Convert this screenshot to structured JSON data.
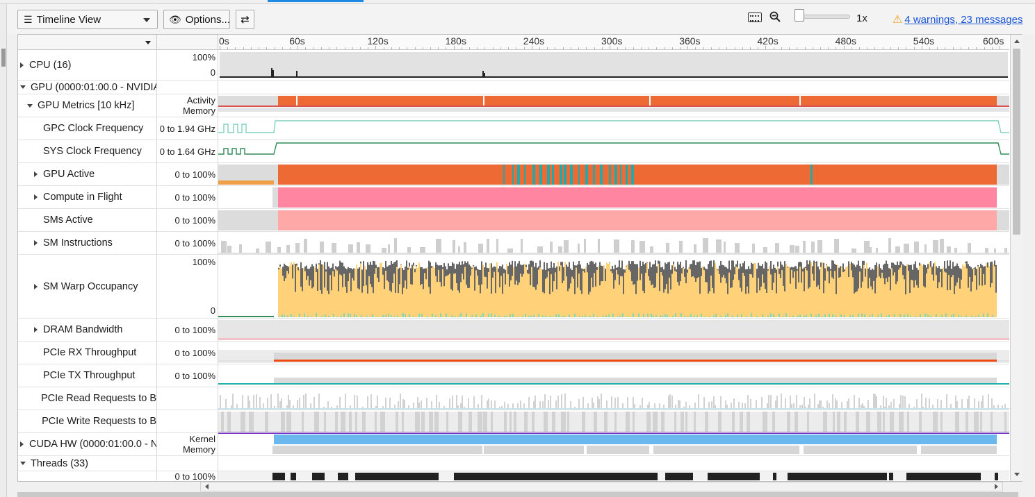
{
  "toolbar": {
    "view_label": "Timeline View",
    "options_label": "Options...",
    "zoom_level": "1x",
    "warnings_link": "4 warnings, 23 messages"
  },
  "ruler": {
    "ticks": [
      "0s",
      "60s",
      "120s",
      "180s",
      "240s",
      "300s",
      "360s",
      "420s",
      "480s",
      "540s",
      "600s"
    ]
  },
  "rows": [
    {
      "id": "cpu",
      "label": "CPU (16)",
      "expander": "collapsed",
      "indent": 0,
      "scale_top": "100%",
      "scale_bottom": "0"
    },
    {
      "id": "gpu",
      "label": "GPU (0000:01:00.0 - NVIDIA",
      "expander": "expanded",
      "indent": 0
    },
    {
      "id": "gpu-metrics",
      "label": "GPU Metrics [10 kHz]",
      "expander": "expanded",
      "indent": 1,
      "scale_top": "Activity",
      "scale_bottom": "Memory"
    },
    {
      "id": "gpc-clock",
      "label": "GPC Clock Frequency",
      "expander": "none",
      "indent": 2,
      "scale": "0 to 1.94 GHz"
    },
    {
      "id": "sys-clock",
      "label": "SYS Clock Frequency",
      "expander": "none",
      "indent": 2,
      "scale": "0 to 1.64 GHz"
    },
    {
      "id": "gpu-active",
      "label": "GPU Active",
      "expander": "collapsed",
      "indent": 2,
      "scale": "0 to 100%"
    },
    {
      "id": "compute-in-flight",
      "label": "Compute in Flight",
      "expander": "collapsed",
      "indent": 2,
      "scale": "0 to 100%"
    },
    {
      "id": "sms-active",
      "label": "SMs Active",
      "expander": "none",
      "indent": 2,
      "scale": "0 to 100%"
    },
    {
      "id": "sm-instructions",
      "label": "SM Instructions",
      "expander": "collapsed",
      "indent": 2,
      "scale": "0 to 100%"
    },
    {
      "id": "sm-warp-occupancy",
      "label": "SM Warp Occupancy",
      "expander": "collapsed",
      "indent": 2,
      "scale_top": "100%",
      "scale_bottom": "0"
    },
    {
      "id": "dram-bandwidth",
      "label": "DRAM Bandwidth",
      "expander": "collapsed",
      "indent": 2,
      "scale": "0 to 100%"
    },
    {
      "id": "pcie-rx",
      "label": "PCIe RX Throughput",
      "expander": "none",
      "indent": 2,
      "scale": "0 to 100%"
    },
    {
      "id": "pcie-tx",
      "label": "PCIe TX Throughput",
      "expander": "none",
      "indent": 2,
      "scale": "0 to 100%"
    },
    {
      "id": "pcie-read",
      "label": "PCIe Read Requests to B",
      "expander": "none",
      "indent": 2
    },
    {
      "id": "pcie-write",
      "label": "PCIe Write Requests to B",
      "expander": "none",
      "indent": 2
    },
    {
      "id": "cuda-hw",
      "label": "CUDA HW (0000:01:00.0 - N",
      "expander": "collapsed",
      "indent": 0,
      "scale_top": "Kernel",
      "scale_bottom": "Memory"
    },
    {
      "id": "threads",
      "label": "Threads (33)",
      "expander": "expanded",
      "indent": 0
    },
    {
      "id": "thread-row",
      "label": "",
      "expander": "none",
      "indent": 2,
      "scale": "0 to 100%"
    }
  ],
  "colors": {
    "cpu": "#222222",
    "activity": "#ee6a35",
    "memory_line": "#d9534f",
    "gpc_clock": "#7fd1c0",
    "sys_clock": "#2e8b57",
    "gpu_active": "#ee6a35",
    "gpu_active_alt": "#26a8a8",
    "compute": "#ff85a1",
    "sms_active": "#ffa8a8",
    "warp_unused": "#666666",
    "warp_active": "#ffd27a",
    "warp_low": "#7fd8b8",
    "pcie_rx": "#f04a10",
    "pcie_tx": "#1fb0a8",
    "grey_bg": "#d9d9d9",
    "kernel": "#6bb8ee",
    "cuda_line": "#7a30c8",
    "threads": "#222222",
    "warning_link": "#1a55d6"
  }
}
